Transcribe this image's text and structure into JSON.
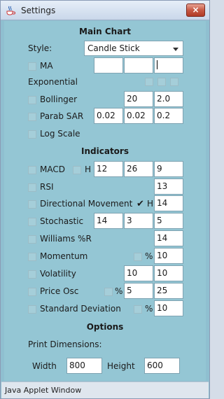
{
  "window": {
    "title": "Settings",
    "close_glyph": "×",
    "status": "Java Applet Window"
  },
  "main_chart": {
    "header": "Main Chart",
    "style_label": "Style:",
    "style_value": "Candle Stick",
    "ma": {
      "label": "MA",
      "values": [
        "",
        "",
        ""
      ]
    },
    "exponential": {
      "label": "Exponential"
    },
    "bollinger": {
      "label": "Bollinger",
      "values": [
        "20",
        "2.0"
      ]
    },
    "parab_sar": {
      "label": "Parab SAR",
      "values": [
        "0.02",
        "0.02",
        "0.2"
      ]
    },
    "log_scale": {
      "label": "Log Scale"
    }
  },
  "indicators": {
    "header": "Indicators",
    "macd": {
      "label": "MACD",
      "h_label": "H",
      "values": [
        "12",
        "26",
        "9"
      ]
    },
    "rsi": {
      "label": "RSI",
      "value": "13"
    },
    "directional_movement": {
      "label": "Directional Movement",
      "h_label": "H",
      "h_checked": true,
      "value": "14"
    },
    "stochastic": {
      "label": "Stochastic",
      "values": [
        "14",
        "3",
        "5"
      ]
    },
    "williams": {
      "label": "Williams %R",
      "value": "14"
    },
    "momentum": {
      "label": "Momentum",
      "pct_label": "%",
      "value": "10"
    },
    "volatility": {
      "label": "Volatility",
      "values": [
        "10",
        "10"
      ]
    },
    "price_osc": {
      "label": "Price Osc",
      "pct_label": "%",
      "values": [
        "5",
        "25"
      ]
    },
    "std_dev": {
      "label": "Standard Deviation",
      "pct_label": "%",
      "value": "10"
    }
  },
  "options": {
    "header": "Options",
    "print_dimensions_label": "Print Dimensions:",
    "width_label": "Width",
    "width_value": "800",
    "height_label": "Height",
    "height_value": "600"
  }
}
